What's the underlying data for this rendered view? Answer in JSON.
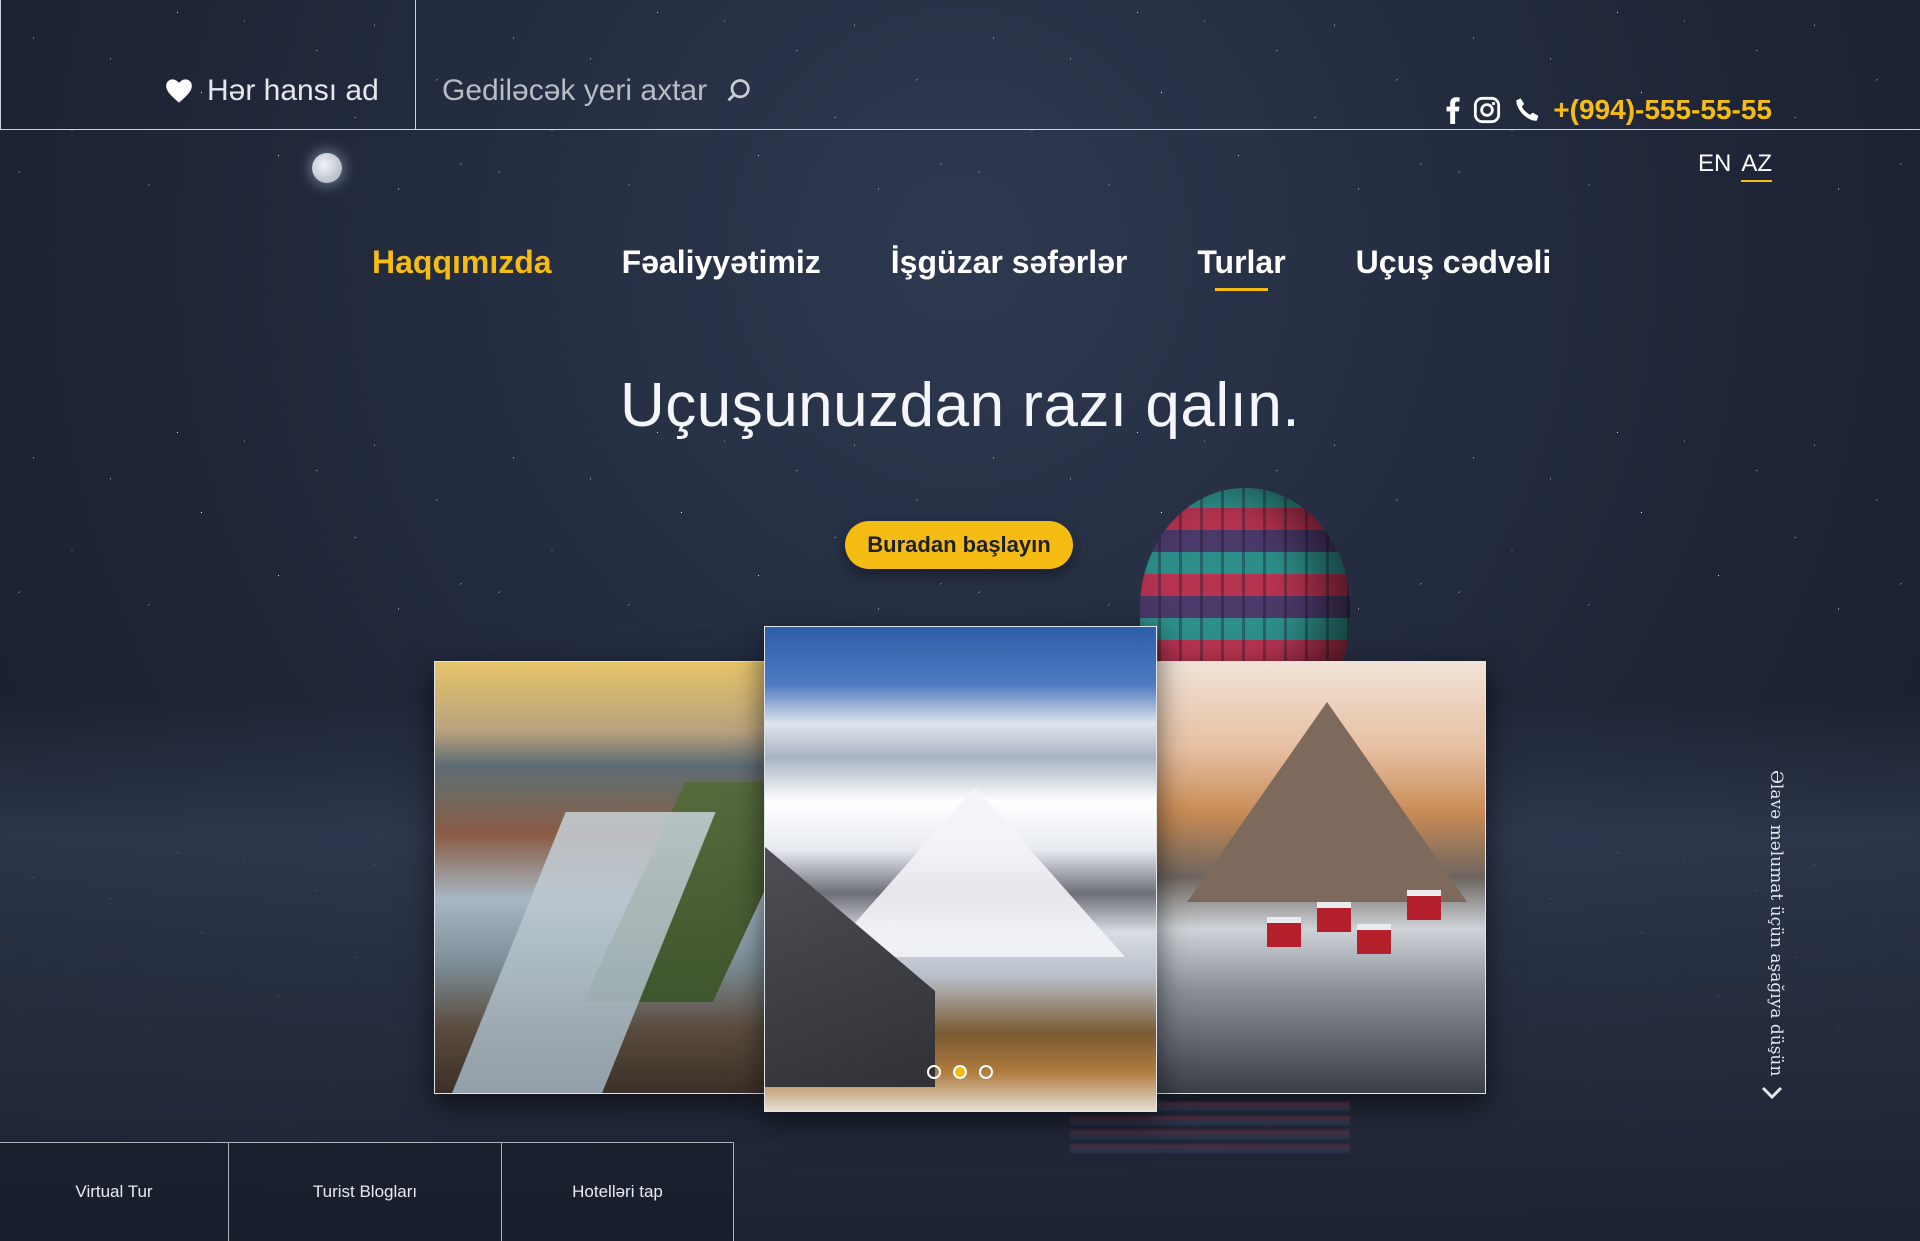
{
  "header": {
    "favorite_label": "Hər hansı ad",
    "search_placeholder": "Gediləcək yeri axtar",
    "phone": "+(994)-555-55-55",
    "languages": [
      {
        "code": "EN",
        "active": false
      },
      {
        "code": "AZ",
        "active": true
      }
    ],
    "social": [
      "facebook-icon",
      "instagram-icon"
    ]
  },
  "nav": {
    "items": [
      {
        "label": "Haqqımızda",
        "state": "accent"
      },
      {
        "label": "Fəaliyyətimiz",
        "state": "normal"
      },
      {
        "label": "İşgüzar səfərlər",
        "state": "normal"
      },
      {
        "label": "Turlar",
        "state": "underlined"
      },
      {
        "label": "Uçuş cədvəli",
        "state": "normal"
      }
    ]
  },
  "hero": {
    "headline": "Uçuşunuzdan razı qalın.",
    "cta_label": "Buradan başlayın"
  },
  "carousel": {
    "slides": [
      "mountain-river-photo",
      "snowy-peak-photo",
      "coastal-village-photo"
    ],
    "active_index": 1
  },
  "side_hint": {
    "text": "Əlavə məlumat üçün aşağıya düşün"
  },
  "bottom_tabs": [
    {
      "label": "Virtual Tur"
    },
    {
      "label": "Turist Blogları"
    },
    {
      "label": "Hotelləri tap"
    }
  ],
  "colors": {
    "accent": "#f5bd13",
    "background": "#1f2638",
    "text": "#ffffff"
  }
}
